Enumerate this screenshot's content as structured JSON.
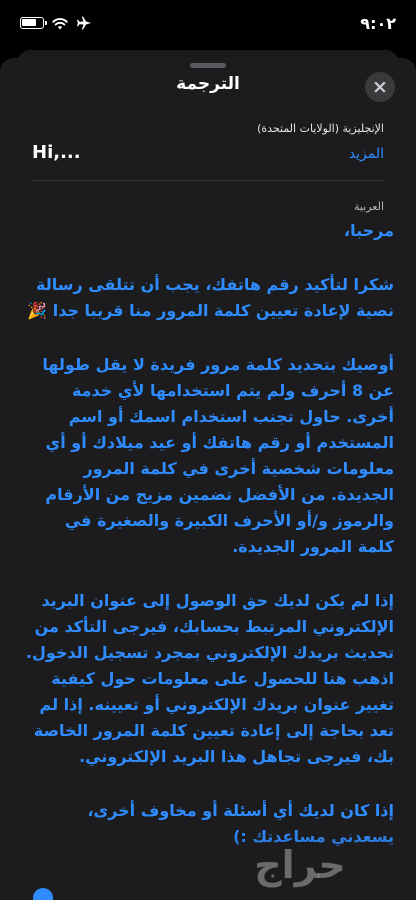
{
  "status_bar": {
    "time": "٩:٠٢",
    "icons": [
      "airplane-icon",
      "wifi-icon",
      "battery-icon"
    ]
  },
  "sheet": {
    "title": "الترجمة",
    "close_icon": "×"
  },
  "source": {
    "language": "الإنجليزية (الولايات المتحدة)",
    "text": "Hi,...",
    "more_label": "المزيد"
  },
  "target": {
    "language": "العربية",
    "paragraphs": [
      "مرحبا،",
      "شكرا لتأكيد رقم هاتفك، يجب أن تتلقى رسالة نصية لإعادة تعيين كلمة المرور منا قريبا جدا 🎉",
      "أوصيك بتحديد كلمة مرور فريدة لا يقل طولها عن 8 أحرف ولم يتم استخدامها لأي خدمة أخرى. حاول تجنب استخدام اسمك أو اسم المستخدم أو رقم هاتفك أو عيد ميلادك أو أي معلومات شخصية أخرى في كلمة المرور الجديدة. من الأفضل تضمين مزيج من الأرقام والرموز و/أو الأحرف الكبيرة والصغيرة في كلمة المرور الجديدة.",
      "إذا لم يكن لديك حق الوصول إلى عنوان البريد الإلكتروني المرتبط بحسابك، فيرجى التأكد من تحديث بريدك الإلكتروني بمجرد تسجيل الدخول. اذهب هنا للحصول على معلومات حول كيفية تغيير عنوان بريدك الإلكتروني أو تعيينه. إذا لم تعد بحاجة إلى إعادة تعيين كلمة المرور الخاصة بك، فيرجى تجاهل هذا البريد الإلكتروني.",
      "إذا كان لديك أي أسئلة أو مخاوف أخرى، يسعدني مساعدتك :)"
    ]
  },
  "watermark": {
    "text": "حراج"
  },
  "colors": {
    "accent": "#2f8cff",
    "sheet_background": "#1c1c1e",
    "page_background": "#000000"
  }
}
